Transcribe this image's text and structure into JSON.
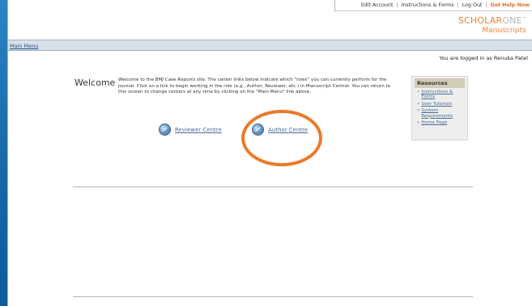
{
  "topbar": {
    "edit_account": "Edit Account",
    "instructions": "Instructions & Forms",
    "logout": "Log Out",
    "help": "Get Help Now"
  },
  "brand": {
    "scholar": "SCHOLAR",
    "one": "ONE",
    "tm": "™",
    "manuscripts": "Manuscripts"
  },
  "nav": {
    "main_menu": "Main Menu"
  },
  "user": {
    "logged_in_text": "You are logged in as Renuka Patel"
  },
  "welcome": {
    "title": "Welcome",
    "text_pre": "Welcome to the ",
    "site_name": "BMJ Case Reports",
    "text_post": " site. The center links below indicate which \"roles\" you can currently perform for the journal. Click on a link to begin working in the role (e.g., Author, Reviewer, etc.) in Manuscript Central. You can return to this screen to change centers at any time by clicking on the \"Main Menu\" link above."
  },
  "centres": {
    "reviewer": "Reviewer Centre",
    "author": "Author Centre"
  },
  "resources": {
    "title": "Resources",
    "items": [
      {
        "label": "Instructions & Forms"
      },
      {
        "label": "User Tutorials"
      },
      {
        "label": "System Requirements"
      },
      {
        "label": "Home Page"
      }
    ]
  },
  "colors": {
    "accent": "#ea7a2b",
    "link": "#4a6d94",
    "background": "#1a6fb0"
  }
}
